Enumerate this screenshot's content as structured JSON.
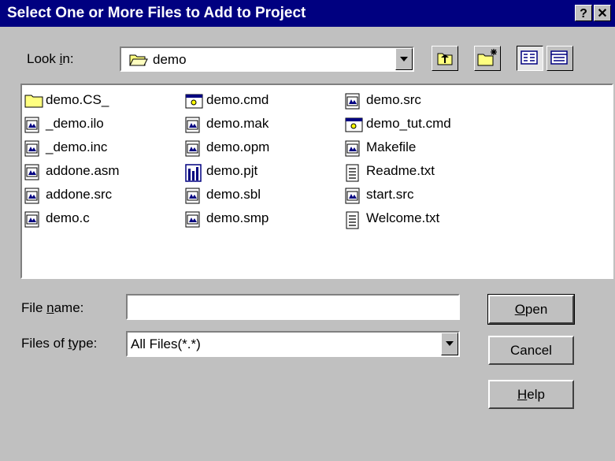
{
  "title": "Select One or More Files to Add to Project",
  "title_buttons": {
    "help": "?",
    "close": "✕"
  },
  "look_in": {
    "label_pre": "Look ",
    "label_key": "i",
    "label_post": "n:",
    "value": "demo"
  },
  "files": {
    "columns": [
      [
        {
          "name": "demo.CS_",
          "icon": "folder-icon"
        },
        {
          "name": "_demo.ilo",
          "icon": "generic-file-icon"
        },
        {
          "name": "_demo.inc",
          "icon": "generic-file-icon"
        },
        {
          "name": "addone.asm",
          "icon": "generic-file-icon"
        },
        {
          "name": "addone.src",
          "icon": "generic-file-icon"
        },
        {
          "name": "demo.c",
          "icon": "generic-file-icon"
        }
      ],
      [
        {
          "name": "demo.cmd",
          "icon": "cmd-file-icon"
        },
        {
          "name": "demo.mak",
          "icon": "generic-file-icon"
        },
        {
          "name": "demo.opm",
          "icon": "generic-file-icon"
        },
        {
          "name": "demo.pjt",
          "icon": "project-file-icon"
        },
        {
          "name": "demo.sbl",
          "icon": "generic-file-icon"
        },
        {
          "name": "demo.smp",
          "icon": "generic-file-icon"
        }
      ],
      [
        {
          "name": "demo.src",
          "icon": "generic-file-icon"
        },
        {
          "name": "demo_tut.cmd",
          "icon": "cmd-file-icon"
        },
        {
          "name": "Makefile",
          "icon": "generic-file-icon"
        },
        {
          "name": "Readme.txt",
          "icon": "text-file-icon"
        },
        {
          "name": "start.src",
          "icon": "generic-file-icon"
        },
        {
          "name": "Welcome.txt",
          "icon": "text-file-icon"
        }
      ]
    ]
  },
  "file_name": {
    "label_pre": "File ",
    "label_key": "n",
    "label_post": "ame:",
    "value": ""
  },
  "file_type": {
    "label_pre": "Files of ",
    "label_key": "t",
    "label_post": "ype:",
    "value": "All Files(*.*)"
  },
  "buttons": {
    "open": {
      "key": "O",
      "rest": "pen"
    },
    "cancel": "Cancel",
    "help": {
      "key": "H",
      "rest": "elp"
    }
  },
  "colors": {
    "titlebar": "#000080",
    "face": "#c0c0c0",
    "folder": "#ffff80",
    "project": "#000080"
  }
}
